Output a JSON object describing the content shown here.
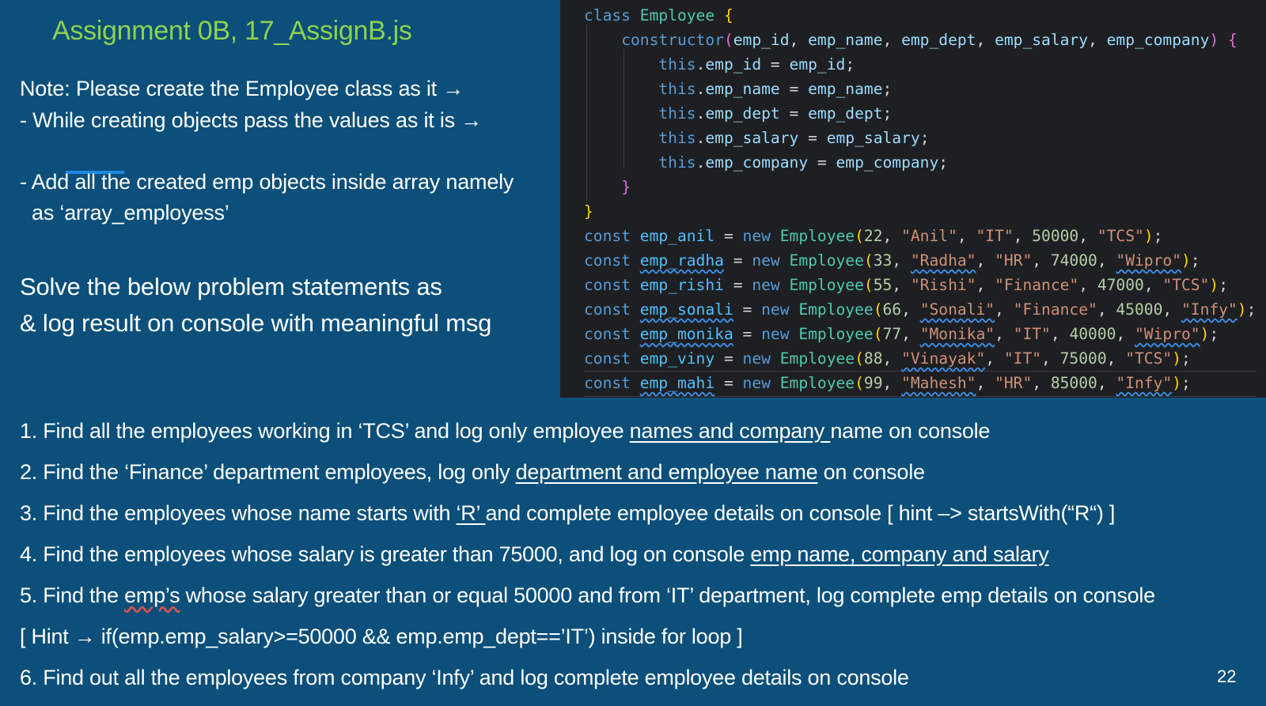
{
  "slide": {
    "title": "Assignment 0B, 17_AssignB.js",
    "notes": [
      "Note: Please create the Employee class as it →",
      "- While creating objects pass the values as it is →",
      "- Add all the created emp objects inside array namely",
      "as ‘array_employess’"
    ],
    "solve": [
      "Solve the below problem statements as",
      "& log result on console with meaningful msg"
    ],
    "page_number": "22"
  },
  "code": {
    "class_kw": "class",
    "class_name": "Employee",
    "ctor": "constructor",
    "params": [
      "emp_id",
      "emp_name",
      "emp_dept",
      "emp_salary",
      "emp_company"
    ],
    "this_kw": "this",
    "const_kw": "const",
    "new_kw": "new",
    "objects": [
      {
        "var": "emp_anil",
        "id": "22",
        "name": "\"Anil\"",
        "dept": "\"IT\"",
        "salary": "50000",
        "company": "\"TCS\""
      },
      {
        "var": "emp_radha",
        "id": "33",
        "name": "\"Radha\"",
        "dept": "\"HR\"",
        "salary": "74000",
        "company": "\"Wipro\""
      },
      {
        "var": "emp_rishi",
        "id": "55",
        "name": "\"Rishi\"",
        "dept": "\"Finance\"",
        "salary": "47000",
        "company": "\"TCS\""
      },
      {
        "var": "emp_sonali",
        "id": "66",
        "name": "\"Sonali\"",
        "dept": "\"Finance\"",
        "salary": "45000",
        "company": "\"Infy\""
      },
      {
        "var": "emp_monika",
        "id": "77",
        "name": "\"Monika\"",
        "dept": "\"IT\"",
        "salary": "40000",
        "company": "\"Wipro\""
      },
      {
        "var": "emp_viny",
        "id": "88",
        "name": "\"Vinayak\"",
        "dept": "\"IT\"",
        "salary": "75000",
        "company": "\"TCS\""
      },
      {
        "var": "emp_mahi",
        "id": "99",
        "name": "\"Mahesh\"",
        "dept": "\"HR\"",
        "salary": "85000",
        "company": "\"Infy\""
      }
    ]
  },
  "questions": [
    {
      "pre": "1. Find all the employees working in ‘TCS’ and  log only employee ",
      "u": "names and company ",
      "post": "name on console"
    },
    {
      "pre": "2. Find the ‘Finance’ department employees, log only ",
      "u": "department and employee name",
      "post": " on console"
    },
    {
      "pre": "3. Find the employees whose name starts with ",
      "u": "‘R’ ",
      "post": "and complete employee details on console [ hint –>  startsWith(“R“) ]"
    },
    {
      "pre": "4. Find the employees whose salary is greater than 75000, and log on console  ",
      "u": "emp name, company and salary",
      "post": ""
    },
    {
      "pre": "5. Find the ",
      "u": "emp’s",
      "post": " whose salary greater than or equal 50000 and from ‘IT’ department, log complete emp details on console"
    },
    {
      "pre": "[ Hint → if(emp.emp_salary>=50000 && emp.emp_dept==’IT’) inside for loop ]",
      "u": "",
      "post": ""
    },
    {
      "pre": "6. Find out all the employees from company ‘Infy’  and log complete employee details on console",
      "u": "",
      "post": ""
    }
  ],
  "colors": {
    "background": "#0b4f7a",
    "title": "#8fd14f",
    "editor_bg": "#1e1f22"
  }
}
